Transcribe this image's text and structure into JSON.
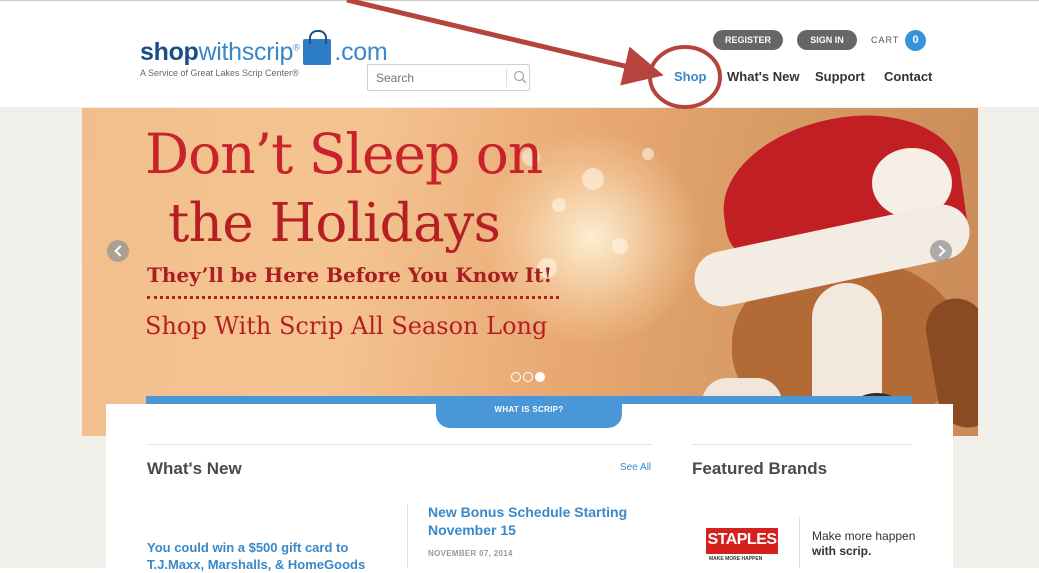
{
  "header": {
    "logo": {
      "bold": "shop",
      "light": "withscrip",
      "reg": "®",
      "dot": ".com",
      "tagline": "A Service of Great Lakes Scrip Center®"
    },
    "search": {
      "placeholder": "Search"
    },
    "account": {
      "register_label": "REGISTER",
      "signin_label": "SIGN IN",
      "cart_label": "CART",
      "cart_count": "0"
    },
    "nav": [
      {
        "label": "Shop"
      },
      {
        "label": "What's New"
      },
      {
        "label": "Support"
      },
      {
        "label": "Contact"
      }
    ]
  },
  "hero": {
    "line1": "Don’t Sleep on",
    "line2": "the Holidays",
    "line3": "They’ll be Here Before You Know It!",
    "line4": "Shop With Scrip All Season Long",
    "slides": 3,
    "active_slide": 3
  },
  "scrip_tab": {
    "label": "WHAT IS SCRIP?"
  },
  "whats_new": {
    "title": "What's New",
    "see_all": "See All",
    "promo_text": "You could win a $500 gift card to T.J.Maxx, Marshalls, & HomeGoods",
    "article": {
      "title": "New Bonus Schedule Starting November 15",
      "date": "NOVEMBER 07, 2014"
    }
  },
  "featured": {
    "title": "Featured Brands",
    "brand": {
      "logo_text": "STAPLES",
      "logo_tagline": "MAKE MORE HAPPEN",
      "line1": "Make more happen",
      "line2": "with scrip."
    }
  },
  "annotation": {
    "color": "#b5443f"
  },
  "colors": {
    "brand_blue": "#3a88c8",
    "hero_red": "#b51f24",
    "bar_blue": "#4a97d8"
  }
}
